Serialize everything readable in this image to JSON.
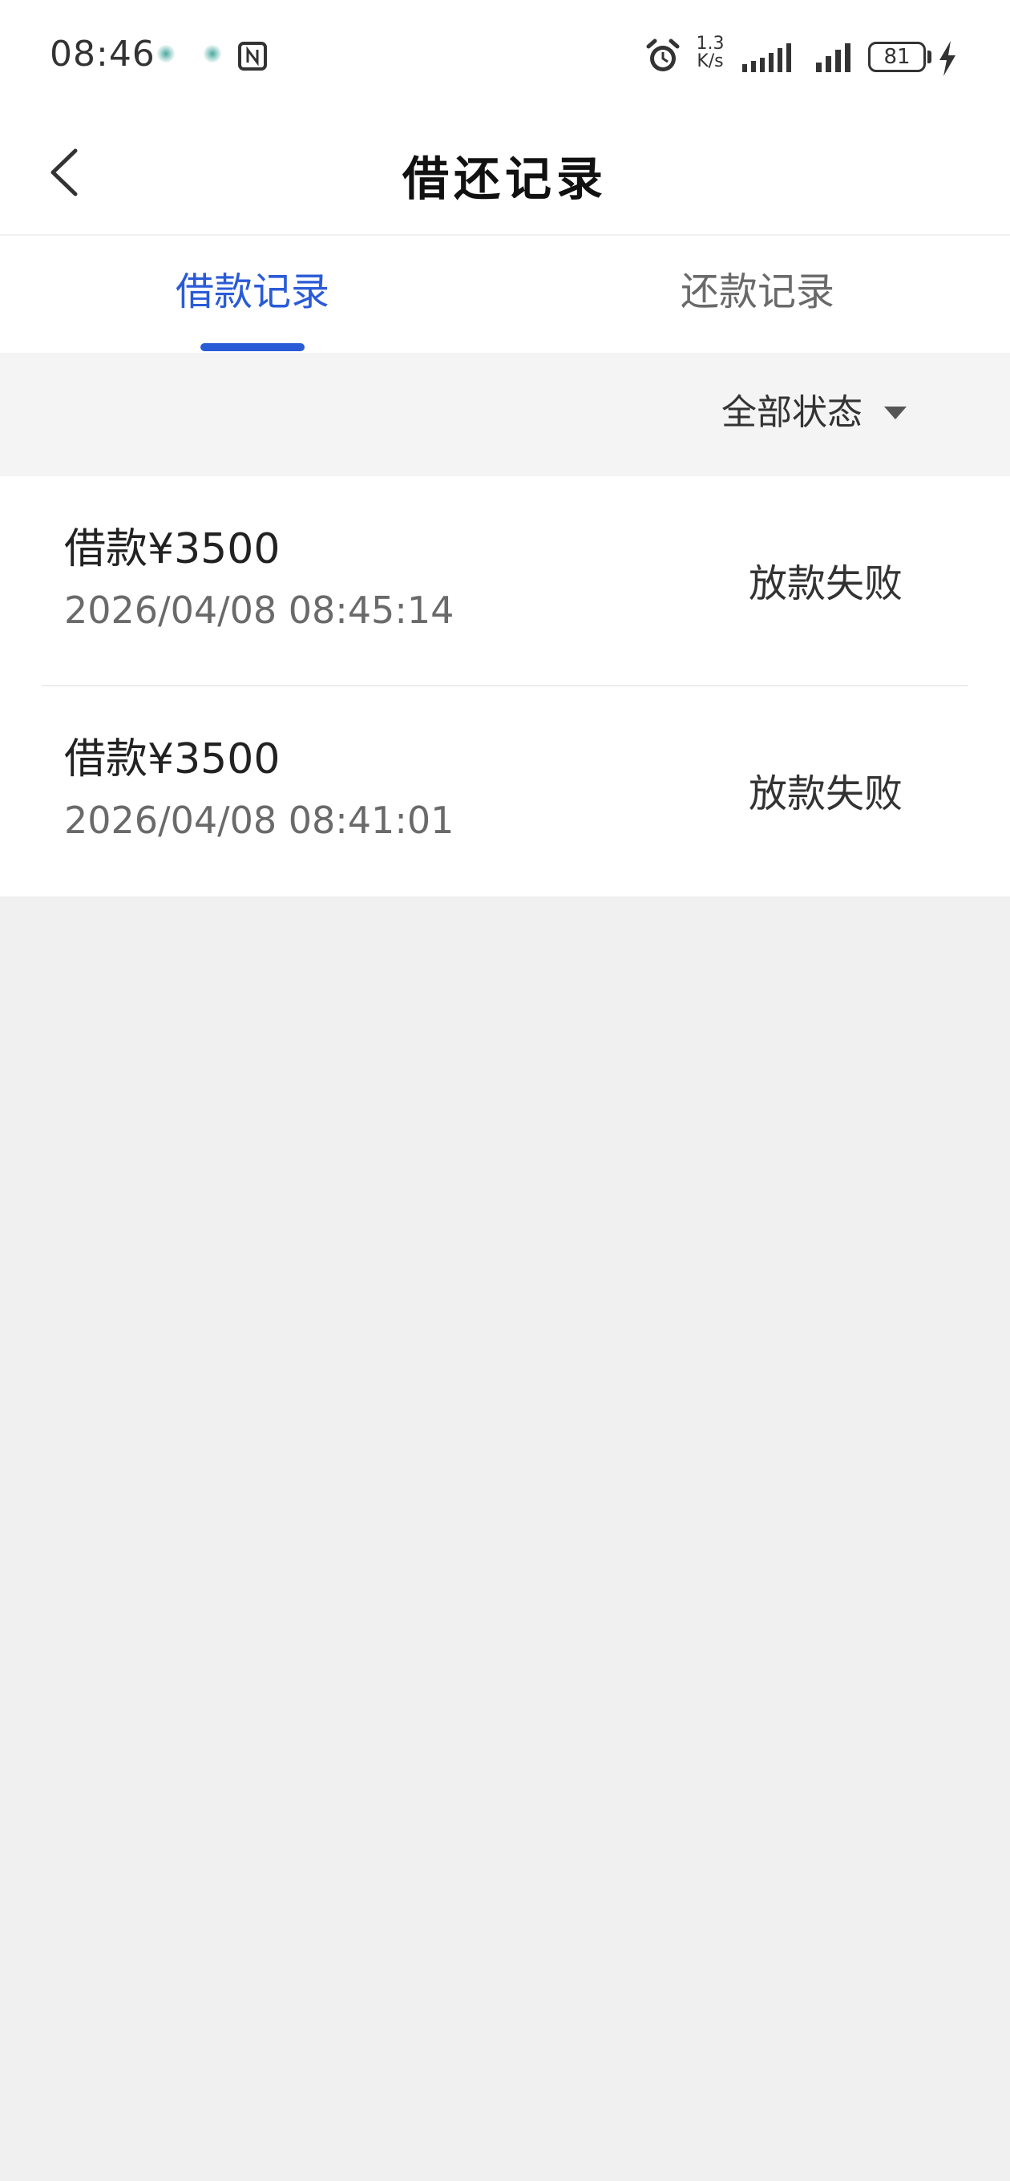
{
  "status_bar": {
    "time": "08:46",
    "speed_value": "1.3",
    "speed_unit": "K/s",
    "battery": "81"
  },
  "header": {
    "title": "借还记录"
  },
  "tabs": [
    {
      "label": "借款记录",
      "active": true
    },
    {
      "label": "还款记录",
      "active": false
    }
  ],
  "filter": {
    "label": "全部状态"
  },
  "records": [
    {
      "amount": "借款¥3500",
      "time": "2026/04/08 08:45:14",
      "status": "放款失败"
    },
    {
      "amount": "借款¥3500",
      "time": "2026/04/08 08:41:01",
      "status": "放款失败"
    }
  ],
  "colors": {
    "accent": "#2a5bd7",
    "background": "#f0f0f0"
  }
}
